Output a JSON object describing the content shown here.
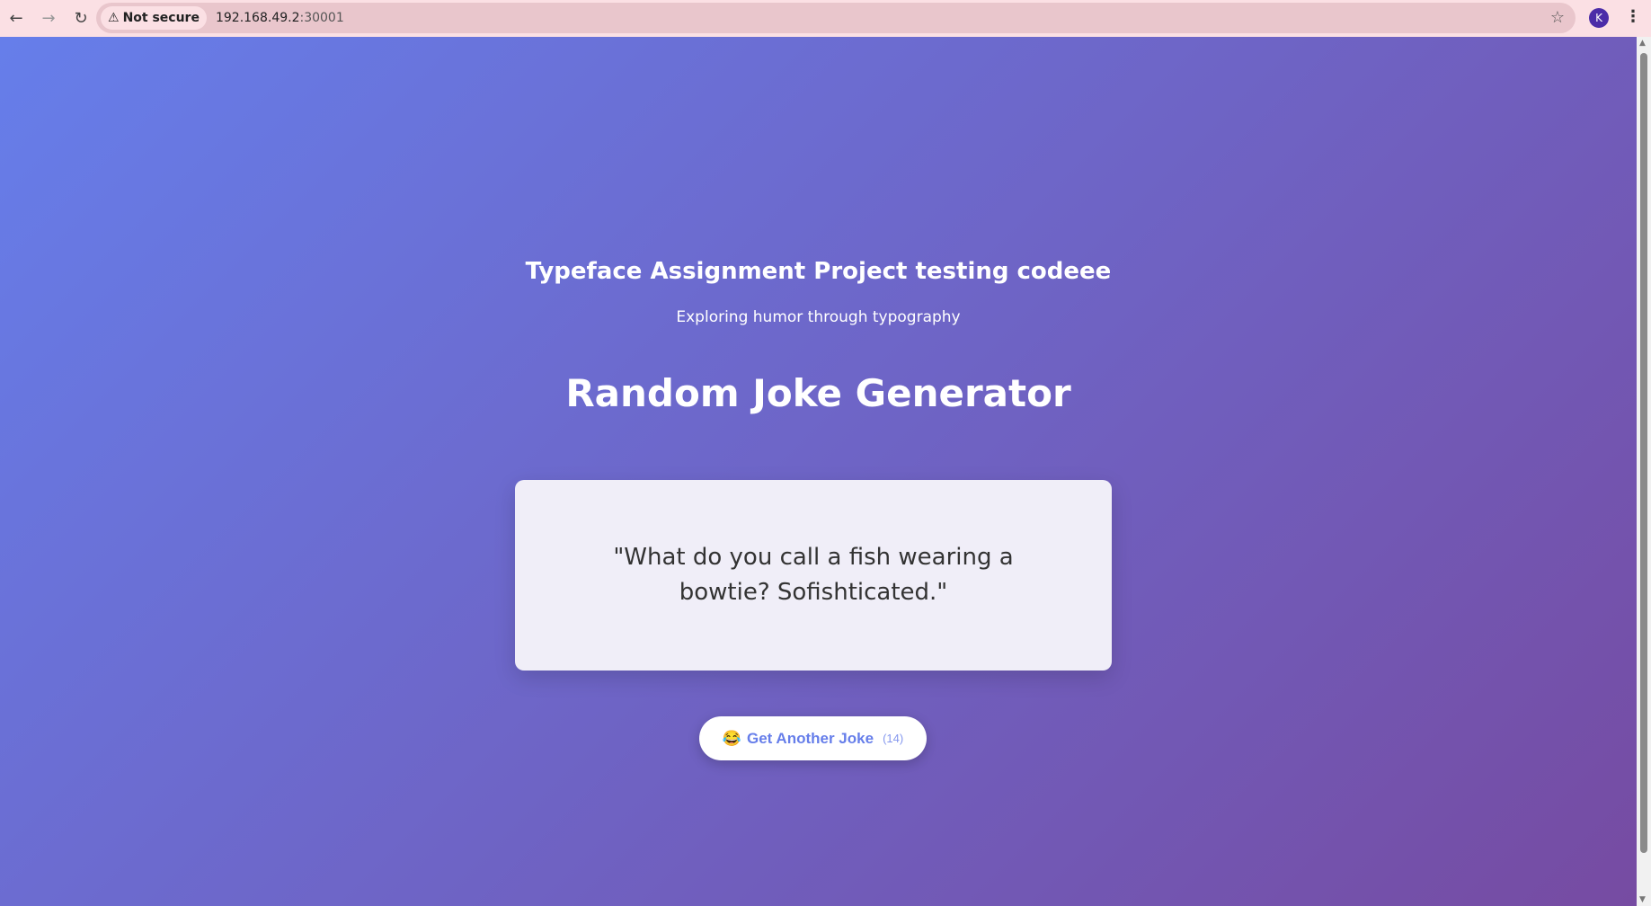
{
  "browser": {
    "security_label": "Not secure",
    "url_host": "192.168.49.2",
    "url_port": ":30001",
    "profile_initial": "K"
  },
  "header": {
    "title": "Typeface Assignment Project testing codeee",
    "subtitle": "Exploring humor through typography"
  },
  "main": {
    "heading": "Random Joke Generator",
    "joke": "\"What do you call a fish wearing a bowtie? Sofishticated.\"",
    "button": {
      "emoji": "😂",
      "label": "Get Another Joke",
      "count": "(14)"
    }
  },
  "colors": {
    "gradient_start": "#667eea",
    "gradient_end": "#764ba2",
    "accent": "#667eea"
  }
}
